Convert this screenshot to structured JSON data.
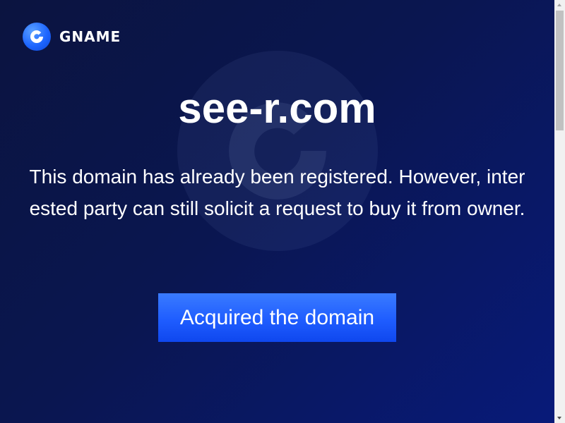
{
  "brand": {
    "name": "GNAME",
    "icon": "gname-g-logo-icon",
    "accent_color": "#1f5dff"
  },
  "main": {
    "domain": "see-r.com",
    "message": "This domain has already been registered. However, interested party can still solicit a request to buy it from owner.",
    "cta_label": "Acquired the domain"
  },
  "background": {
    "watermark_icon": "gname-g-watermark-icon"
  }
}
